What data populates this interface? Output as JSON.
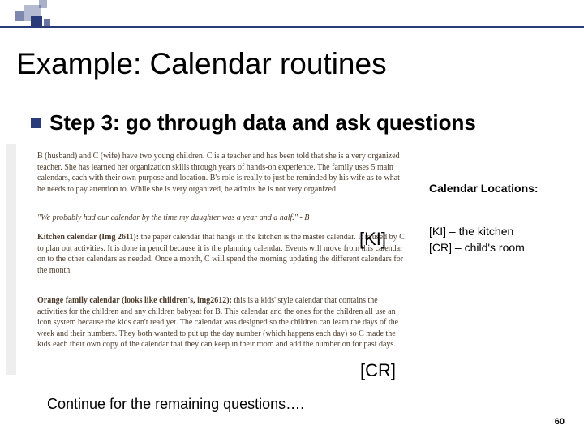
{
  "slide": {
    "title": "Example: Calendar routines",
    "bullet": "Step 3: go through data and ask questions",
    "continue": "Continue for the remaining questions….",
    "page_number": "60"
  },
  "document": {
    "para1": "B (husband) and C (wife) have two young children.  C is a teacher and has been told that she is a very organized teacher.  She has learned her organization skills through years of hands-on experience.  The family uses 5 main calendars, each with their own purpose and location.  B's role is really to just be reminded by his wife as to what he needs to pay attention to.  While she is very organized, he admits he is not very organized.",
    "para2": "\"We probably had our calendar by the time my daughter was a year and a half.\" - B",
    "para3_bold": "Kitchen calendar (Img 2611):",
    "para3_rest": " the paper calendar that hangs in the kitchen is the master calendar.  It is used by C to plan out activities.  It is done in pencil because it is the planning calendar. Events will move from this calendar on to the other calendars as needed.  Once a month, C will spend the morning updating the different calendars for the month.",
    "para4_bold": "Orange family calendar (looks like children's, img2612):",
    "para4_rest": " this is a kids' style calendar that contains the activities for the children and any children babysat for B. This calendar and the ones for the children all use an icon system because the kids can't read yet. The calendar was designed so the children can learn the days of the week and their numbers. They both wanted to put up the day number (which happens each day) so C made the kids each their own copy of the calendar that they can keep in their room and add the number on for past days."
  },
  "annotations": {
    "ki": "[KI]",
    "cr": "[CR]"
  },
  "sidebar": {
    "title": "Calendar Locations:",
    "legend_ki": "[KI] – the kitchen",
    "legend_cr": "[CR] – child's room"
  }
}
